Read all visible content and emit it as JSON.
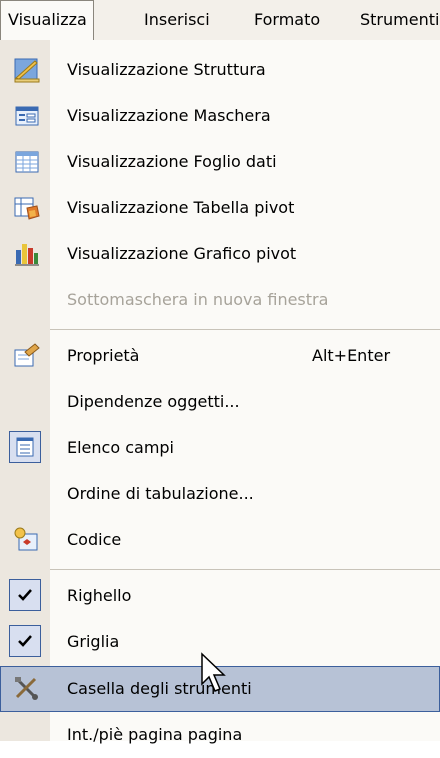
{
  "menubar": {
    "items": [
      "Visualizza",
      "Inserisci",
      "Formato",
      "Strumenti"
    ]
  },
  "menu": {
    "items": [
      {
        "label": "Visualizzazione Struttura",
        "icon": "design-view-icon"
      },
      {
        "label": "Visualizzazione Maschera",
        "icon": "form-view-icon"
      },
      {
        "label": "Visualizzazione Foglio dati",
        "icon": "datasheet-view-icon"
      },
      {
        "label": "Visualizzazione Tabella pivot",
        "icon": "pivot-table-icon"
      },
      {
        "label": "Visualizzazione Grafico pivot",
        "icon": "pivot-chart-icon"
      },
      {
        "label": "Sottomaschera in nuova finestra",
        "disabled": true
      },
      {
        "label": "Proprietà",
        "shortcut": "Alt+Enter",
        "icon": "properties-icon"
      },
      {
        "label": "Dipendenze oggetti..."
      },
      {
        "label": "Elenco campi",
        "icon": "field-list-icon"
      },
      {
        "label": "Ordine di tabulazione..."
      },
      {
        "label": "Codice",
        "icon": "code-icon"
      },
      {
        "label": "Righello",
        "checked": true
      },
      {
        "label": "Griglia",
        "checked": true
      },
      {
        "label": "Casella degli strumenti",
        "icon": "toolbox-icon",
        "highlighted": true
      },
      {
        "label": "Int./piè pagina pagina"
      }
    ]
  },
  "colors": {
    "menubar_bg": "#f3f0ea",
    "menu_bg": "#fbfaf7",
    "gutter_bg": "#ece7df",
    "highlight_bg": "#b7c2d6",
    "highlight_border": "#3c5f9c",
    "disabled_text": "#a7a39a"
  }
}
